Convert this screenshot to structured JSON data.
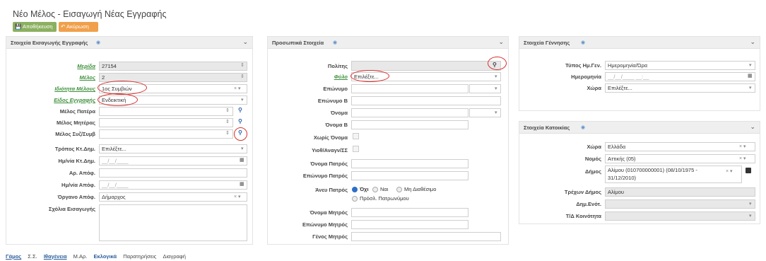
{
  "page": {
    "title": "Νέο Μέλος - Εισαγωγή Νέας Εγγραφής",
    "save_label": "Αποθήκευση",
    "cancel_label": "Ακύρωση"
  },
  "registration": {
    "header": "Στοιχεία Εισαγωγής Εγγραφής",
    "merida_label": "Μερίδα",
    "merida_value": "27154",
    "melos_label": "Μέλος",
    "melos_value": "2",
    "idiotita_label": "Ιδιότητα Μέλους",
    "idiotita_value": "1ος Συμβιών",
    "eidos_label": "Είδος Εγγραφής",
    "eidos_value": "Ενδεικτική",
    "patera_label": "Μέλος Πατέρα",
    "mitera_label": "Μέλος Μητέρας",
    "syzygos_label": "Μέλος Συζ/Συμβ",
    "tropos_label": "Τρόπος Κτ.Δημ.",
    "tropos_value": "Επιλέξτε...",
    "hm_kt_label": "Ημ/νία Κτ.Δημ.",
    "hm_kt_value": "__/__/____",
    "ar_apof_label": "Αρ. Απόφ.",
    "hm_apof_label": "Ημ/νία Απόφ.",
    "hm_apof_value": "__/__/____",
    "organo_label": "Όργανο Απόφ.",
    "organo_value": "Δήμαρχος",
    "sxolia_label": "Σχόλια Εισαγωγής"
  },
  "personal": {
    "header": "Προσωπικά Στοιχεία",
    "politis_label": "Πολίτης",
    "fylo_label": "Φύλο",
    "fylo_value": "Επιλέξτε...",
    "eponymo_label": "Επώνυμο",
    "eponymo_b_label": "Επώνυμο Β",
    "onoma_label": "Όνομα",
    "onoma_b_label": "Όνομα Β",
    "xoris_onoma_label": "Χωρίς Όνομα",
    "yiothesia_label": "Υιοθ/Αναγν/ΣΣ",
    "onoma_patros_label": "Όνομα Πατρός",
    "eponymo_patros_label": "Επώνυμο Πατρός",
    "aneu_patros_label": "Άνευ Πατρός",
    "radio_oxi": "Όχι",
    "radio_nai": "Ναι",
    "radio_mh": "Μη Διαθέσιμο",
    "radio_prosl": "Πρόσλ. Πατρωνύμου",
    "onoma_mitros_label": "Όνομα Μητρός",
    "eponymo_mitros_label": "Επώνυμο Μητρός",
    "genos_mitros_label": "Γένος Μητρός"
  },
  "birth": {
    "header": "Στοιχεία Γέννησης",
    "typos_label": "Τύπος Ημ.Γεν.",
    "typos_value": "Ημερομηνία/Ώρα",
    "hm_label": "Ημερομηνία",
    "hm_value": "__/__/____ __:__",
    "xora_label": "Χώρα",
    "xora_value": "Επιλέξτε..."
  },
  "residence": {
    "header": "Στοιχεία Κατοικίας",
    "xora_label": "Χώρα",
    "xora_value": "Ελλάδα",
    "nomos_label": "Νομός",
    "nomos_value": "Αττικής (05)",
    "dimos_label": "Δήμος",
    "dimos_value_1": "Αλίμου (010700000001) (08/10/1975 -",
    "dimos_value_2": "31/12/2010)",
    "trexon_label": "Τρέχων Δήμος",
    "trexon_value": "Αλίμου",
    "dim_en_label": "Δημ.Ενότ.",
    "koinotita_label": "Τ/Δ Κοινότητα"
  },
  "tabs": [
    "Γάμος",
    "Σ.Σ.",
    "Ιθαγένεια",
    "Μ.Αρ.",
    "Εκλογικά",
    "Παρατηρήσεις",
    "Διαγραφή"
  ]
}
